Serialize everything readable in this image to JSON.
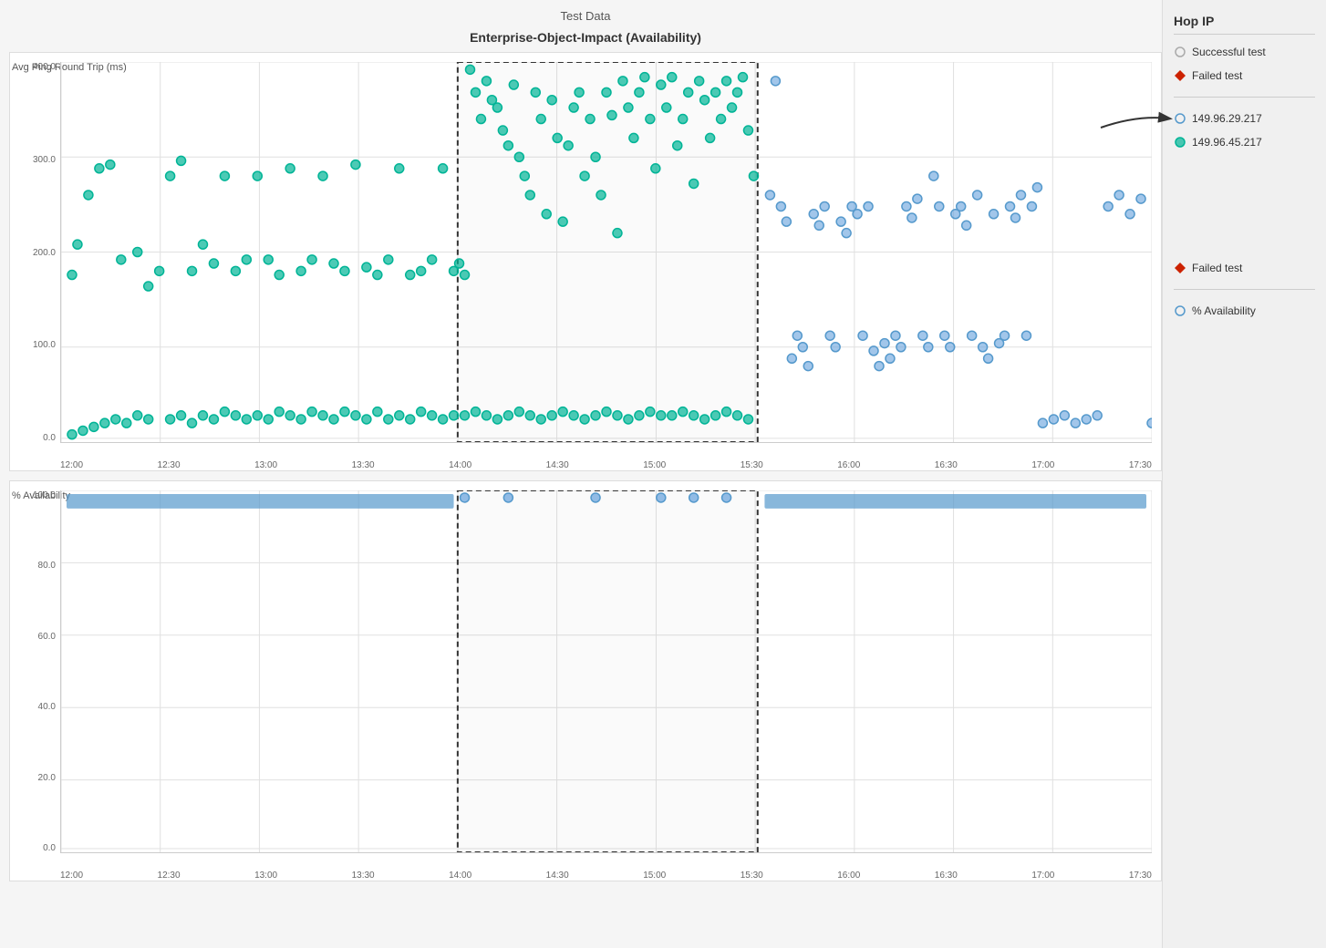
{
  "page": {
    "title": "Test Data",
    "chart_title": "Enterprise-Object-Impact (Availability)"
  },
  "sidebar": {
    "title": "Hop IP",
    "legend": [
      {
        "type": "circle",
        "color": "#aaa",
        "label": "Successful test"
      },
      {
        "type": "diamond",
        "color": "#cc2200",
        "label": "Failed test"
      }
    ],
    "ips": [
      {
        "color": "#5599cc",
        "label": "149.96.29.217"
      },
      {
        "color": "#00b496",
        "label": "149.96.45.217"
      }
    ],
    "legend2": [
      {
        "type": "diamond",
        "color": "#cc2200",
        "label": "Failed test"
      },
      {
        "type": "circle",
        "color": "#5599cc",
        "label": "% Availability"
      }
    ]
  },
  "top_chart": {
    "y_label": "Avg Ping Round Trip (ms)",
    "y_ticks": [
      "400.0",
      "300.0",
      "200.0",
      "100.0",
      "0.0"
    ],
    "x_ticks": [
      "12:00",
      "12:30",
      "13:00",
      "13:30",
      "14:00",
      "14:30",
      "15:00",
      "15:30",
      "16:00",
      "16:30",
      "17:00",
      "17:30"
    ]
  },
  "bottom_chart": {
    "y_label": "% Availability",
    "y_ticks": [
      "100.0",
      "80.0",
      "60.0",
      "40.0",
      "20.0",
      "0.0"
    ],
    "x_ticks": [
      "12:00",
      "12:30",
      "13:00",
      "13:30",
      "14:00",
      "14:30",
      "15:00",
      "15:30",
      "16:00",
      "16:30",
      "17:00",
      "17:30"
    ]
  }
}
